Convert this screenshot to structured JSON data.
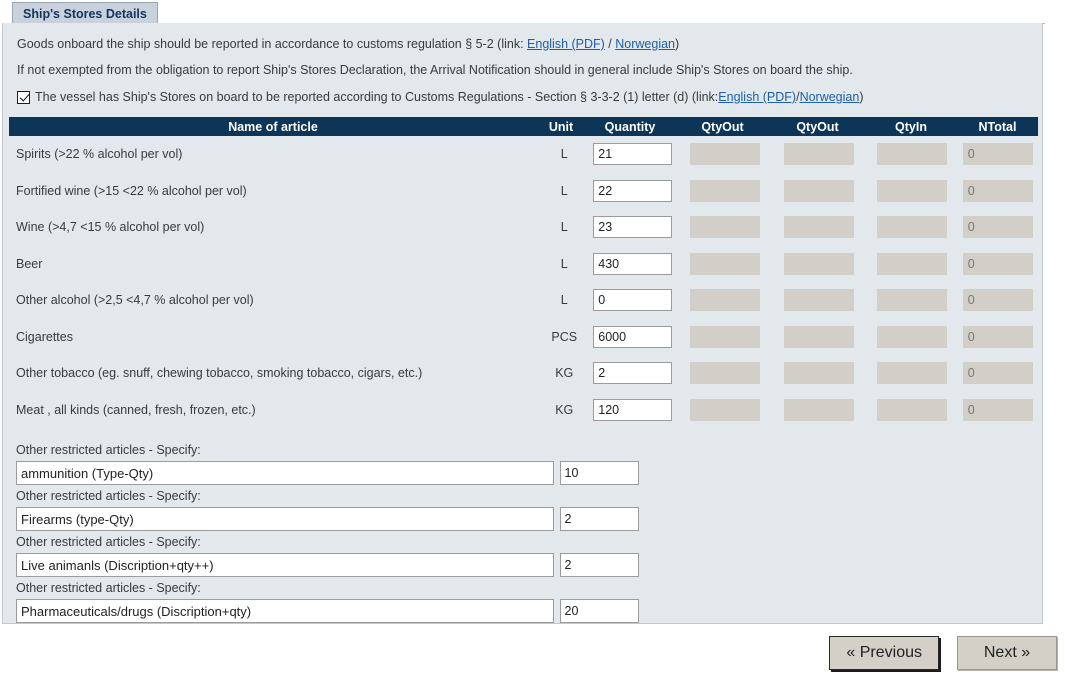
{
  "tab": {
    "label": "Ship's Stores Details"
  },
  "intro": {
    "line1_pre": "Goods onboard the ship should be reported in accordance to customs regulation § 5-2 (link: ",
    "line1_link1": "English (PDF)",
    "line1_sep": " / ",
    "line1_link2": "Norwegian",
    "line1_post": ")",
    "line2": "If not exempted from the obligation to report Ship's Stores Declaration, the Arrival Notification should in general include Ship's Stores on board the ship.",
    "checkbox_pre": "The vessel has Ship's Stores on board to be reported according to Customs Regulations - Section § 3-3-2 (1) letter (d) (link: ",
    "checkbox_link1": "English (PDF)",
    "checkbox_sep": " / ",
    "checkbox_link2": "Norwegian",
    "checkbox_post": ")",
    "checkbox_checked": true
  },
  "table": {
    "headers": {
      "name": "Name of article",
      "unit": "Unit",
      "quantity": "Quantity",
      "qtyout1": "QtyOut",
      "qtyout2": "QtyOut",
      "qtyin": "QtyIn",
      "ntotal": "NTotal"
    },
    "rows": [
      {
        "name": "Spirits (>22 % alcohol per vol)",
        "unit": "L",
        "quantity": "21",
        "qtyout1": "",
        "qtyout2": "",
        "qtyin": "",
        "ntotal": "0"
      },
      {
        "name": "Fortified wine (>15 <22 % alcohol per vol)",
        "unit": "L",
        "quantity": "22",
        "qtyout1": "",
        "qtyout2": "",
        "qtyin": "",
        "ntotal": "0"
      },
      {
        "name": "Wine (>4,7 <15 % alcohol per vol)",
        "unit": "L",
        "quantity": "23",
        "qtyout1": "",
        "qtyout2": "",
        "qtyin": "",
        "ntotal": "0"
      },
      {
        "name": "Beer",
        "unit": "L",
        "quantity": "430",
        "qtyout1": "",
        "qtyout2": "",
        "qtyin": "",
        "ntotal": "0"
      },
      {
        "name": "Other alcohol (>2,5 <4,7 % alcohol per vol)",
        "unit": "L",
        "quantity": "0",
        "qtyout1": "",
        "qtyout2": "",
        "qtyin": "",
        "ntotal": "0"
      },
      {
        "name": "Cigarettes",
        "unit": "PCS",
        "quantity": "6000",
        "qtyout1": "",
        "qtyout2": "",
        "qtyin": "",
        "ntotal": "0"
      },
      {
        "name": "Other tobacco (eg. snuff, chewing tobacco, smoking tobacco, cigars, etc.)",
        "unit": "KG",
        "quantity": "2",
        "qtyout1": "",
        "qtyout2": "",
        "qtyin": "",
        "ntotal": "0"
      },
      {
        "name": "Meat , all kinds (canned, fresh, frozen, etc.)",
        "unit": "KG",
        "quantity": "120",
        "qtyout1": "",
        "qtyout2": "",
        "qtyin": "",
        "ntotal": "0"
      }
    ]
  },
  "other_restricted": {
    "label": "Other restricted articles - Specify:",
    "items": [
      {
        "label": "Other restricted articles - Specify:",
        "description": "ammunition (Type-Qty)",
        "quantity": "10"
      },
      {
        "label": "Other restricted articles - Specify:",
        "description": "Firearms (type-Qty)",
        "quantity": "2"
      },
      {
        "label": "Other restricted articles - Specify:",
        "description": "Live animanls (Discription+qty++)",
        "quantity": "2"
      },
      {
        "label": "Other restricted articles - Specify:",
        "description": "Pharmaceuticals/drugs (Discription+qty)",
        "quantity": "20"
      }
    ]
  },
  "footer": {
    "previous_label": "« Previous",
    "next_label": "Next »"
  },
  "colors": {
    "header_navy": "#0c3557",
    "panel_bg": "#e2e8ec",
    "tab_bg": "#c9d2dc",
    "tab_text": "#12355f",
    "disabled_field": "#d2cec8",
    "link": "#1f5fa8",
    "button_face": "#d4d0c8"
  }
}
